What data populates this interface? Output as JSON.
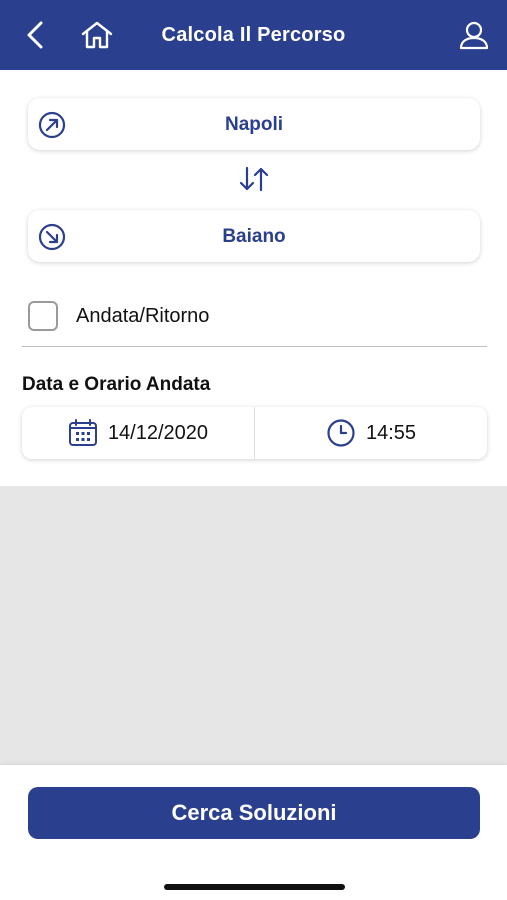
{
  "header": {
    "title": "Calcola Il Percorso",
    "back_icon": "chevron-left-icon",
    "home_icon": "home-icon",
    "user_icon": "user-icon"
  },
  "route": {
    "from": "Napoli",
    "to": "Baiano",
    "from_icon": "arrow-up-right-circle-icon",
    "to_icon": "arrow-down-right-circle-icon",
    "swap_icon": "swap-vertical-icon"
  },
  "round_trip": {
    "label": "Andata/Ritorno",
    "checked": false
  },
  "departure": {
    "section_title": "Data e Orario Andata",
    "date": "14/12/2020",
    "time": "14:55",
    "date_icon": "calendar-icon",
    "time_icon": "clock-icon"
  },
  "actions": {
    "search_label": "Cerca Soluzioni"
  },
  "colors": {
    "primary": "#2b3f8f",
    "background": "#ffffff",
    "results_background": "#e6e6e6"
  }
}
